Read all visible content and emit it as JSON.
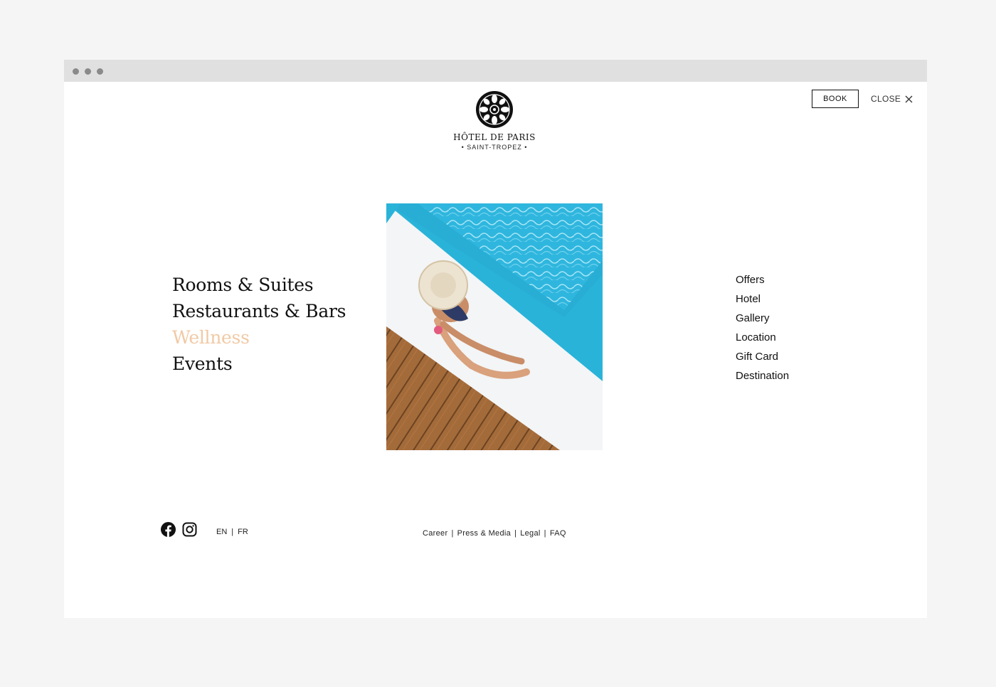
{
  "header": {
    "logo_name": "HÔTEL DE PARIS",
    "logo_subtitle": "• SAINT-TROPEZ •",
    "book_label": "BOOK",
    "close_label": "CLOSE"
  },
  "primary_nav": {
    "items": [
      {
        "label": "Rooms & Suites"
      },
      {
        "label": "Restaurants & Bars"
      },
      {
        "label": "Wellness"
      },
      {
        "label": "Events"
      }
    ],
    "active": "Wellness",
    "active_color": "#f1c9a4"
  },
  "secondary_nav": {
    "items": [
      {
        "label": "Offers"
      },
      {
        "label": "Hotel"
      },
      {
        "label": "Gallery"
      },
      {
        "label": "Location"
      },
      {
        "label": "Gift Card"
      },
      {
        "label": "Destination"
      }
    ]
  },
  "footer": {
    "social": [
      "facebook-icon",
      "instagram-icon"
    ],
    "languages": [
      "EN",
      "FR"
    ],
    "separator": "|",
    "links": [
      "Career",
      "Press & Media",
      "Legal",
      "FAQ"
    ]
  },
  "colors": {
    "pool": "#2ab3d9",
    "deck": "#a06a3c"
  }
}
